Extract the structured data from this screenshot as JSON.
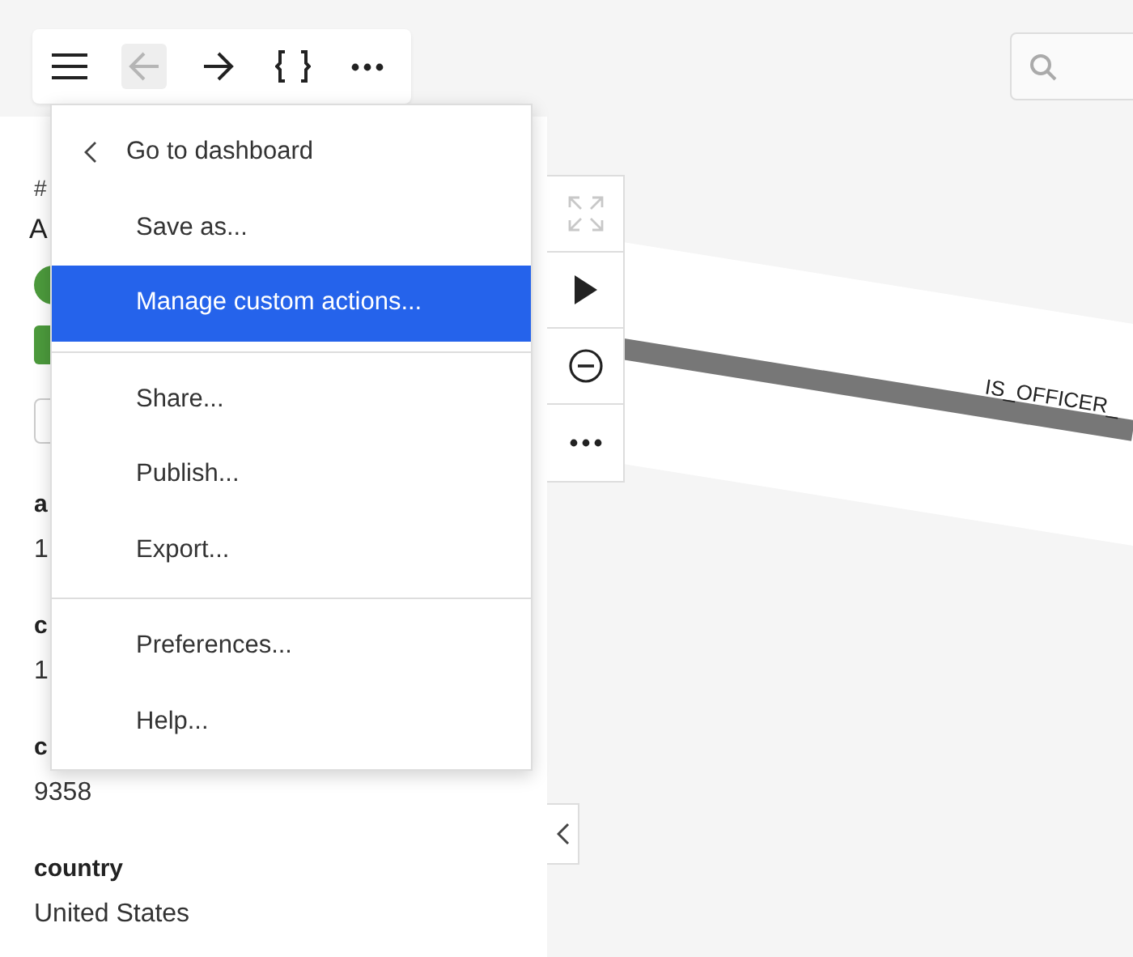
{
  "toolbar": {
    "buttons": [
      {
        "kind": "menu",
        "disabled": false
      },
      {
        "kind": "back",
        "disabled": true
      },
      {
        "kind": "forward",
        "disabled": false
      },
      {
        "kind": "braces",
        "disabled": false
      },
      {
        "kind": "more",
        "disabled": false
      }
    ]
  },
  "menu": {
    "groups": [
      [
        {
          "kind": "back",
          "label": "Go to dashboard",
          "selected": false
        },
        {
          "kind": "item",
          "label": "Save as...",
          "selected": false
        },
        {
          "kind": "item",
          "label": "Manage custom actions...",
          "selected": true
        }
      ],
      [
        {
          "kind": "item",
          "label": "Share...",
          "selected": false
        },
        {
          "kind": "item",
          "label": "Publish...",
          "selected": false
        },
        {
          "kind": "item",
          "label": "Export...",
          "selected": false
        }
      ],
      [
        {
          "kind": "item",
          "label": "Preferences...",
          "selected": false
        },
        {
          "kind": "item",
          "label": "Help...",
          "selected": false
        }
      ]
    ]
  },
  "details": {
    "id_prefix": "#",
    "title": "A",
    "fields": [
      {
        "label": "a",
        "value": "1"
      },
      {
        "label": "c",
        "value": "1"
      },
      {
        "label": "c",
        "value": "9358"
      },
      {
        "label": "country",
        "value": "United States"
      }
    ]
  },
  "graph_controls": [
    {
      "kind": "fit",
      "disabled": true
    },
    {
      "kind": "play",
      "disabled": false
    },
    {
      "kind": "remove",
      "disabled": false
    },
    {
      "kind": "more",
      "disabled": false
    }
  ],
  "edge": {
    "label": "IS_OFFICER_"
  }
}
